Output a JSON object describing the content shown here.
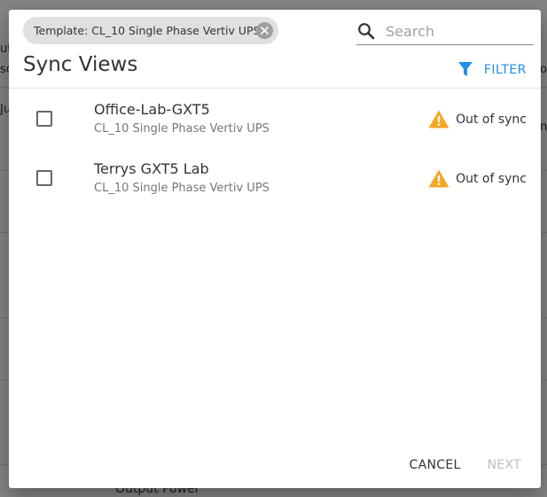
{
  "background": {
    "fragments": [
      "ut",
      "sc",
      "Ju",
      "o",
      "n",
      "Output Power"
    ]
  },
  "dialog": {
    "chip": {
      "label": "Template: CL_10 Single Phase Vertiv UPS",
      "close_icon": "close-circle-icon"
    },
    "search": {
      "placeholder": "Search",
      "value": "",
      "icon": "search-icon"
    },
    "title": "Sync Views",
    "filter": {
      "label": "FILTER",
      "icon": "funnel-icon",
      "color": "#1e90e8"
    },
    "rows": [
      {
        "name": "Office-Lab-GXT5",
        "template": "CL_10 Single Phase Vertiv UPS",
        "status": "Out of sync",
        "checked": false,
        "status_icon": "warning-icon"
      },
      {
        "name": "Terrys GXT5 Lab",
        "template": "CL_10 Single Phase Vertiv UPS",
        "status": "Out of sync",
        "checked": false,
        "status_icon": "warning-icon"
      }
    ],
    "actions": {
      "cancel_label": "CANCEL",
      "next_label": "NEXT"
    },
    "colors": {
      "accent": "#1e90e8",
      "warning": "#f5a623",
      "disabled": "#bdbdbd"
    }
  }
}
